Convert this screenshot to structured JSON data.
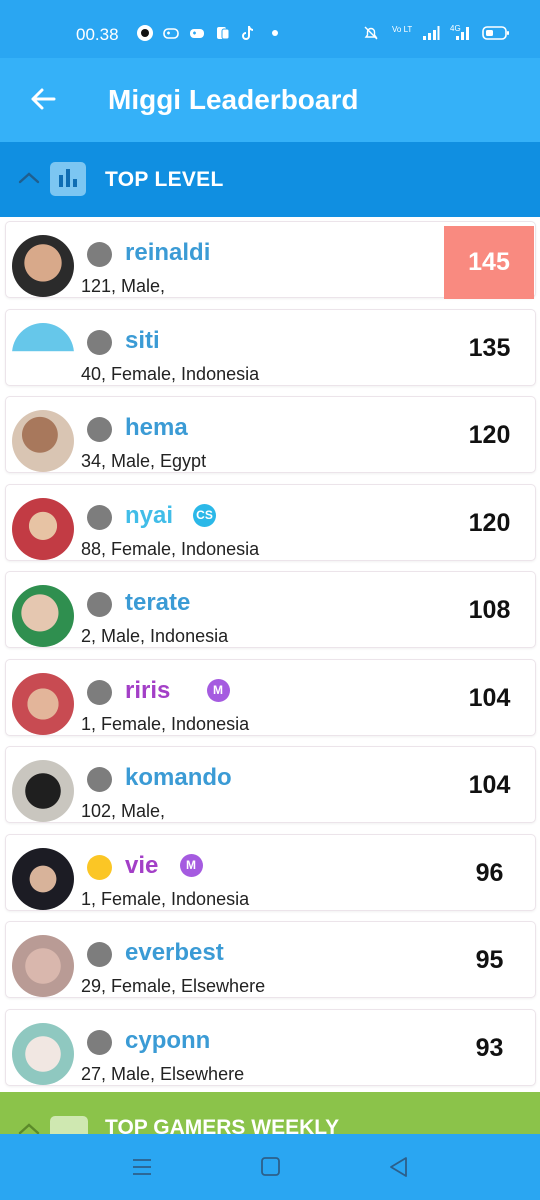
{
  "status_bar": {
    "time": "00.38",
    "icons_left": [
      "music-icon",
      "gamepad-outline-icon",
      "gamepad-icon",
      "cards-icon",
      "tiktok-icon",
      "dot-icon"
    ],
    "icons_right": [
      "mute-bell-icon",
      "volte-icon",
      "signal-icon",
      "4g-signal-icon",
      "battery-icon"
    ],
    "volte_label": "Vo LTE",
    "network_label": "4G"
  },
  "app_bar": {
    "title": "Miggi Leaderboard",
    "back_icon": "arrow-left-icon"
  },
  "section": {
    "title": "TOP LEVEL",
    "icon": "bar-chart-icon"
  },
  "leaderboard": [
    {
      "username": "reinaldi",
      "info": "121, Male,",
      "score": "145",
      "online": false,
      "badge": "",
      "highlight": true,
      "name_color": "#3B9BD5"
    },
    {
      "username": "siti",
      "info": "40, Female, Indonesia",
      "score": "135",
      "online": false,
      "badge": "",
      "highlight": false,
      "name_color": "#3B9BD5"
    },
    {
      "username": "hema",
      "info": "34, Male, Egypt",
      "score": "120",
      "online": false,
      "badge": "",
      "highlight": false,
      "name_color": "#3B9BD5"
    },
    {
      "username": "nyai",
      "info": "88, Female, Indonesia",
      "score": "120",
      "online": false,
      "badge": "CS",
      "highlight": false,
      "name_color": "#41BDE8"
    },
    {
      "username": "terate",
      "info": "2, Male, Indonesia",
      "score": "108",
      "online": false,
      "badge": "",
      "highlight": false,
      "name_color": "#3B9BD5"
    },
    {
      "username": "riris",
      "info": "1, Female, Indonesia",
      "score": "104",
      "online": false,
      "badge": "M",
      "highlight": false,
      "name_color": "#A33FC7"
    },
    {
      "username": "komando",
      "info": "102, Male,",
      "score": "104",
      "online": false,
      "badge": "",
      "highlight": false,
      "name_color": "#3B9BD5"
    },
    {
      "username": "vie",
      "info": "1, Female, Indonesia",
      "score": "96",
      "online": true,
      "badge": "M",
      "highlight": false,
      "name_color": "#A33FC7"
    },
    {
      "username": "everbest",
      "info": "29, Female, Elsewhere",
      "score": "95",
      "online": false,
      "badge": "",
      "highlight": false,
      "name_color": "#3B9BD5"
    },
    {
      "username": "cyponn",
      "info": "27, Male, Elsewhere",
      "score": "93",
      "online": false,
      "badge": "",
      "highlight": false,
      "name_color": "#3B9BD5"
    }
  ],
  "next_section": {
    "title": "TOP GAMERS WEEKLY",
    "icon": "gamepad-icon"
  },
  "nav_bar": {
    "buttons": [
      "menu-icon",
      "home-square-icon",
      "back-triangle-icon"
    ]
  },
  "colors": {
    "status_bar": "#2AA6F2",
    "app_bar": "#35B1F8",
    "section_header": "#108FE1",
    "highlight_score": "#F98A80",
    "next_section": "#8BC34A"
  }
}
